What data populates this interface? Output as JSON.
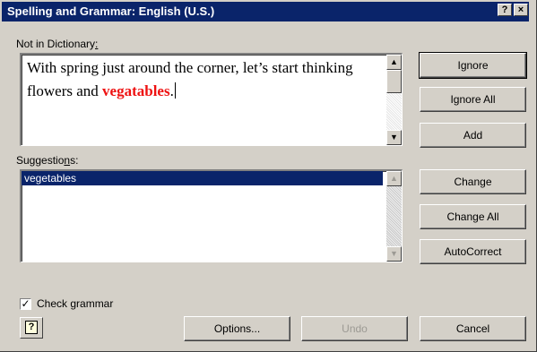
{
  "window": {
    "title": "Spelling and Grammar: English (U.S.)",
    "help_glyph": "?",
    "close_glyph": "×"
  },
  "not_in_dictionary": {
    "label_prefix": "Not in Dictionary",
    "label_underline": ":",
    "text_before": "With spring just around the corner, let’s start thinking flowers and ",
    "error_word": "vegatables",
    "text_after": "."
  },
  "suggestions": {
    "label_a": "Suggestio",
    "label_u": "n",
    "label_b": "s:",
    "items": [
      "vegetables"
    ]
  },
  "buttons": {
    "ignore": "Ignore",
    "ignore_all": "Ignore All",
    "add": "Add",
    "change": "Change",
    "change_all": "Change All",
    "autocorrect": "AutoCorrect",
    "options": "Options...",
    "undo": "Undo",
    "cancel": "Cancel"
  },
  "check_grammar": {
    "label": "Check grammar",
    "checked": true
  },
  "colors": {
    "title_bar": "#0a246a",
    "dialog_face": "#d4d0c8",
    "error_text": "#ee1111",
    "selection": "#0a246a"
  }
}
